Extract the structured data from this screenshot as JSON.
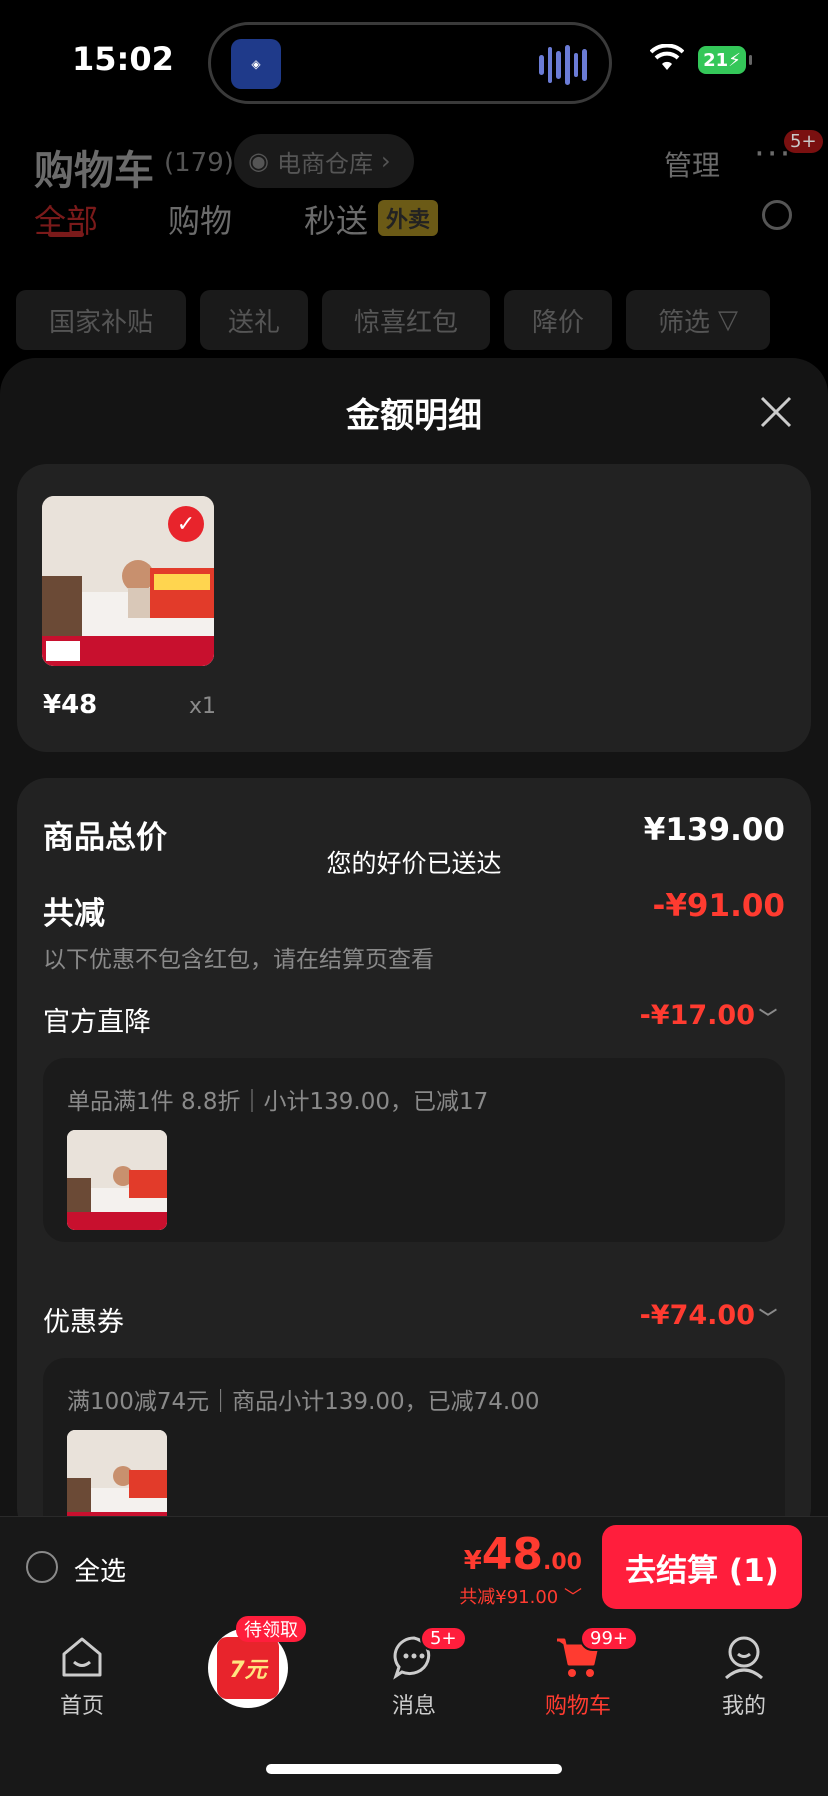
{
  "status_bar": {
    "time": "15:02",
    "battery": "21"
  },
  "background_page": {
    "title": "购物车",
    "count": "(179)",
    "warehouse_label": "电商仓库",
    "manage_label": "管理",
    "more_badge": "5+",
    "tabs": [
      {
        "label": "全部"
      },
      {
        "label": "购物"
      },
      {
        "label": "秒送"
      }
    ],
    "waimai_label": "外卖",
    "filters": [
      {
        "label": "国家补贴"
      },
      {
        "label": "送礼"
      },
      {
        "label": "惊喜红包"
      },
      {
        "label": "降价"
      },
      {
        "label": "筛选"
      }
    ]
  },
  "sheet": {
    "title": "金额明细",
    "product": {
      "price": "¥48",
      "qty": "x1"
    },
    "total_label": "商品总价",
    "total_value": "¥139.00",
    "toast": "您的好价已送达",
    "discount_label": "共减",
    "discount_value": "-¥91.00",
    "note": "以下优惠不包含红包，请在结算页查看",
    "official": {
      "label": "官方直降",
      "value": "-¥17.00",
      "detail": "单品满1件 8.8折｜小计139.00，已减17"
    },
    "coupon": {
      "label": "优惠券",
      "value": "-¥74.00",
      "detail": "满100减74元｜商品小计139.00，已减74.00"
    }
  },
  "checkout": {
    "select_all": "全选",
    "currency": "¥",
    "total_int": "48",
    "total_dec": ".00",
    "saved": "共减¥91.00",
    "pay_button": "去结算 (1)"
  },
  "tabbar": {
    "items": [
      {
        "label": "首页"
      },
      {
        "label": "消息",
        "badge": "5+"
      },
      {
        "label": "购物车",
        "badge": "99+"
      },
      {
        "label": "我的"
      }
    ],
    "redpack_badge": "待领取",
    "redpack_amount": "7元"
  },
  "colors": {
    "accent": "#ff1e3c",
    "price_red": "#ff3b30",
    "sheet_bg": "#141414",
    "card_bg": "#222222"
  }
}
